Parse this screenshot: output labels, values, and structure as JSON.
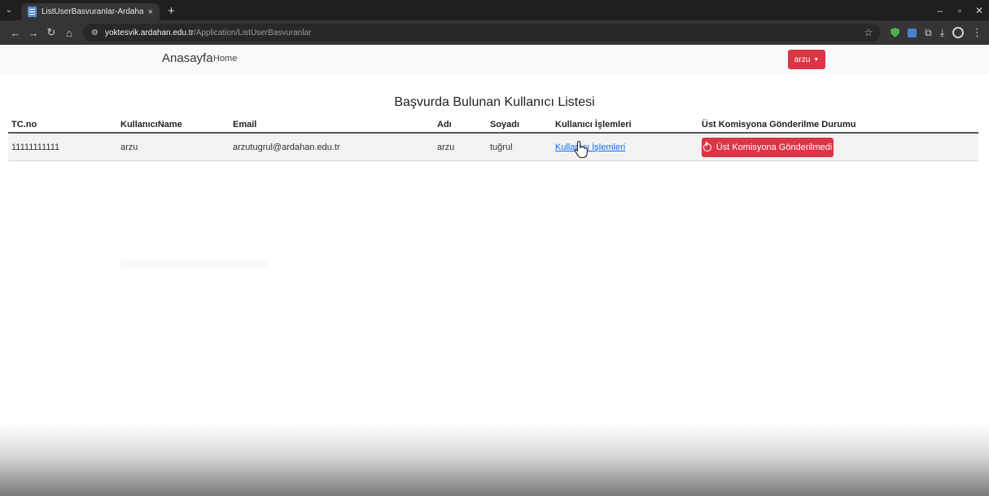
{
  "browser": {
    "tab_title": "ListUserBasvuranlar-Ardahan Ü",
    "tab_close": "×",
    "new_tab": "+",
    "url_host": "yoktesvik.ardahan.edu.tr",
    "url_path": "/Application/ListUserBasvuranlar"
  },
  "navbar": {
    "brand": "Anasayfa",
    "home": "Home",
    "user_label": "arzu",
    "user_color": "#dc3545"
  },
  "page": {
    "title": "Başvurda Bulunan Kullanıcı Listesi"
  },
  "table": {
    "headers": [
      "TC.no",
      "KullanıcıName",
      "Email",
      "Adı",
      "Soyadı",
      "Kullanıcı İşlemleri",
      "Üst Komisyona Gönderilme Durumu"
    ],
    "rows": [
      {
        "tc": "11111111111",
        "username": "arzu",
        "email": "arzutugrul@ardahan.edu.tr",
        "first_name": "arzu",
        "last_name": "tuğrul",
        "actions_link": "Kullanıcı İşlemleri",
        "status": "Üst Komisyona Gönderilmedi",
        "status_color": "#dc3545"
      }
    ]
  }
}
